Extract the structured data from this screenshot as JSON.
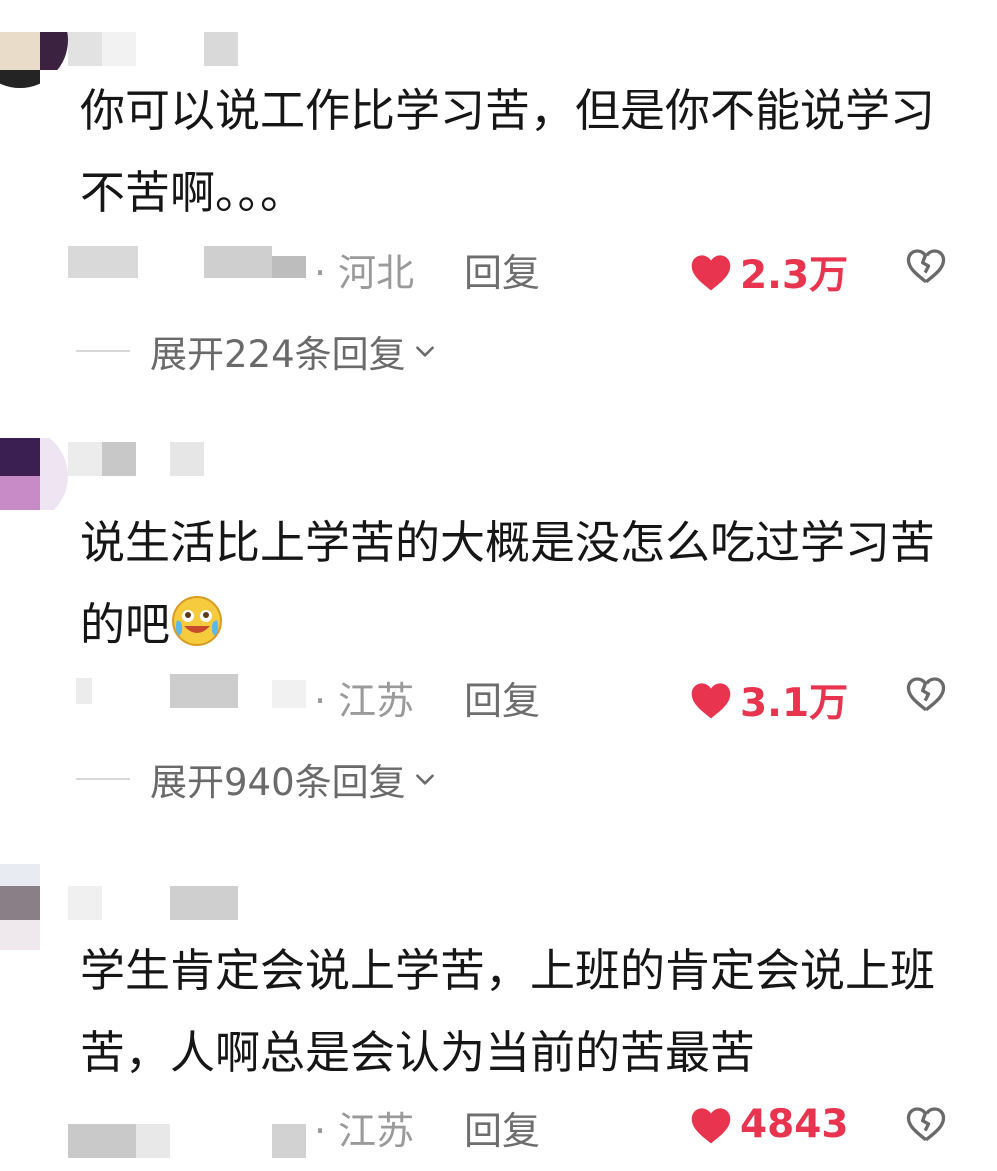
{
  "comments": [
    {
      "text": "你可以说工作比学习苦，但是你不能说学习不苦啊。。。",
      "region": "· 河北",
      "reply_label": "回复",
      "likes": "2.3万",
      "expand_label": "展开224条回复"
    },
    {
      "text": "说生活比上学苦的大概是没怎么吃过学习苦的吧",
      "region": "· 江苏",
      "reply_label": "回复",
      "likes": "3.1万",
      "expand_label": "展开940条回复"
    },
    {
      "text": "学生肯定会说上学苦，上班的肯定会说上班苦，人啊总是会认为当前的苦最苦",
      "region": "· 江苏",
      "reply_label": "回复",
      "likes": "4843"
    }
  ],
  "colors": {
    "like_red": "#e8344f",
    "text_dark": "#161616",
    "meta_gray": "#9a9a9a"
  },
  "icons": [
    "heart-icon",
    "broken-heart-icon",
    "chevron-down-icon",
    "crying-laughing-emoji"
  ]
}
